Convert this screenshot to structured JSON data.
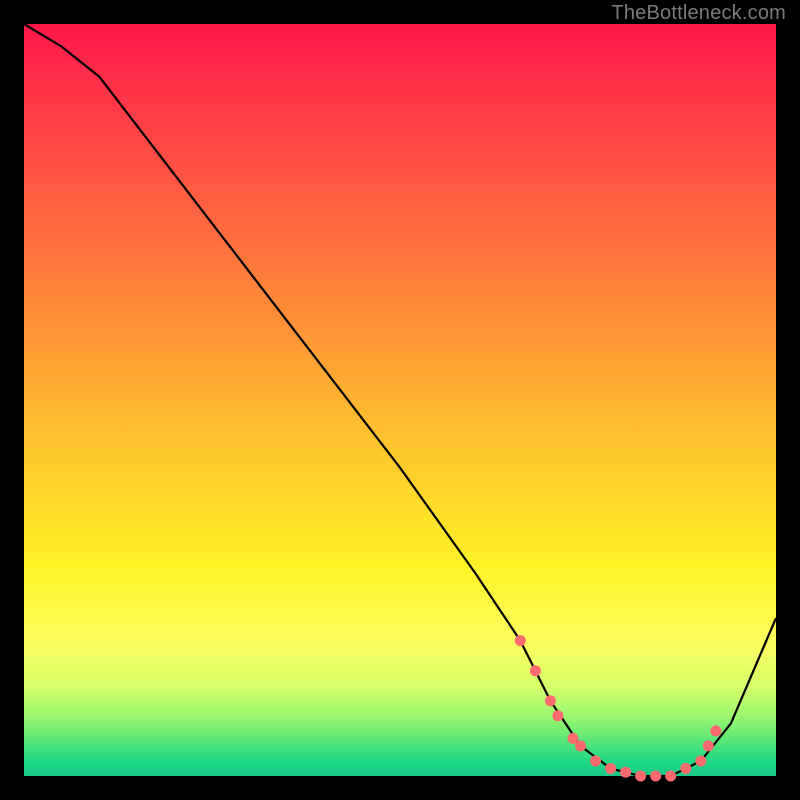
{
  "watermark": "TheBottleneck.com",
  "chart_data": {
    "type": "line",
    "title": "",
    "xlabel": "",
    "ylabel": "",
    "xlim": [
      0,
      100
    ],
    "ylim": [
      0,
      100
    ],
    "series": [
      {
        "name": "bottleneck-curve",
        "x": [
          0,
          5,
          10,
          20,
          30,
          40,
          50,
          60,
          66,
          70,
          74,
          78,
          82,
          86,
          90,
          94,
          100
        ],
        "values": [
          100,
          97,
          93,
          80,
          67,
          54,
          41,
          27,
          18,
          10,
          4,
          1,
          0,
          0,
          2,
          7,
          21
        ]
      }
    ],
    "markers": {
      "name": "highlighted-points",
      "color": "#ff6a6f",
      "x": [
        66,
        68,
        70,
        71,
        73,
        74,
        76,
        78,
        80,
        82,
        84,
        86,
        88,
        90,
        91,
        92
      ],
      "values": [
        18,
        14,
        10,
        8,
        5,
        4,
        2,
        1,
        0.5,
        0,
        0,
        0,
        1,
        2,
        4,
        6
      ]
    }
  }
}
